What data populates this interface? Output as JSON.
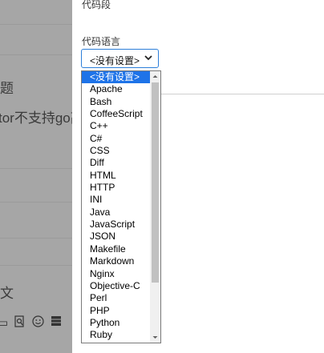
{
  "background": {
    "snippets": [
      "题",
      "tor不支持go高",
      "文"
    ],
    "toolbar_icons": [
      "document-icon",
      "search-doc-icon",
      "smiley-icon",
      "grid-icon"
    ]
  },
  "dialog": {
    "title": "代码段",
    "language_label": "代码语言",
    "language_select": {
      "value": "<没有设置>",
      "options": [
        "<没有设置>",
        "Apache",
        "Bash",
        "CoffeeScript",
        "C++",
        "C#",
        "CSS",
        "Diff",
        "HTML",
        "HTTP",
        "INI",
        "Java",
        "JavaScript",
        "JSON",
        "Makefile",
        "Markdown",
        "Nginx",
        "Objective-C",
        "Perl",
        "PHP",
        "Python",
        "Ruby"
      ],
      "selected_index": 0
    }
  },
  "colors": {
    "selection": "#1e73e8",
    "select_border": "#2d7fd9",
    "overlay": "#a6a6a6"
  }
}
